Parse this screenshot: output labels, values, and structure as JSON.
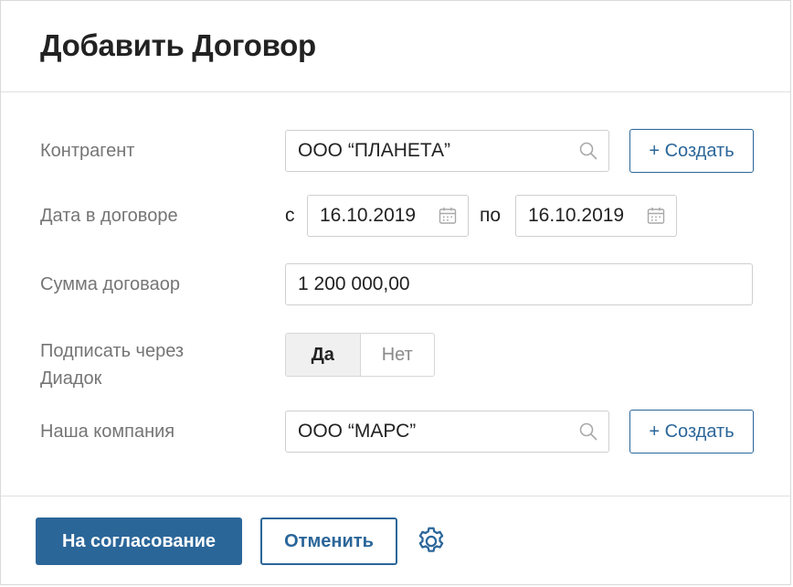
{
  "dialog": {
    "title": "Добавить Договор"
  },
  "form": {
    "counterparty": {
      "label": "Контрагент",
      "value": "ООО “ПЛАНЕТА”",
      "create_label": "+ Создать"
    },
    "contract_date": {
      "label": "Дата в договоре",
      "from_label": "с",
      "from_value": "16.10.2019",
      "to_label": "по",
      "to_value": "16.10.2019"
    },
    "amount": {
      "label": "Сумма договаор",
      "value": "1 200 000,00"
    },
    "diadoc": {
      "label_line1": "Подписать через",
      "label_line2": "Диадок",
      "yes_label": "Да",
      "no_label": "Нет",
      "selected": "yes"
    },
    "our_company": {
      "label": "Наша компания",
      "value": "ООО “МАРС”",
      "create_label": "+ Создать"
    }
  },
  "footer": {
    "submit_label": "На согласование",
    "cancel_label": "Отменить"
  },
  "colors": {
    "accent": "#2b6699",
    "label": "#757575",
    "border": "#cfcfcf"
  }
}
